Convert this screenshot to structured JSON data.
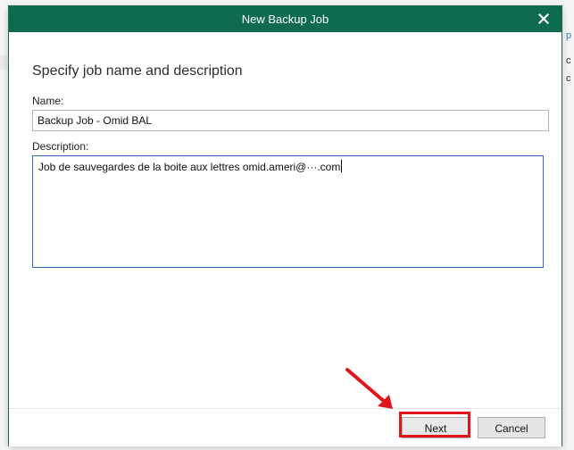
{
  "background": {
    "right_edge_text": [
      "p",
      "c",
      "c"
    ]
  },
  "dialog": {
    "title": "New Backup Job",
    "heading": "Specify job name and description",
    "name_label": "Name:",
    "name_value": "Backup Job - Omid BAL",
    "description_label": "Description:",
    "description_value": "Job de sauvegardes de la boite aux lettres omid.ameri@···.com",
    "next_label": "Next",
    "cancel_label": "Cancel"
  },
  "colors": {
    "titlebar": "#0e6b4f",
    "annotation": "#e0151b",
    "focus_border": "#2f6fb5"
  },
  "icons": {
    "close": "close-icon",
    "annotation_arrow": "arrow-icon"
  }
}
